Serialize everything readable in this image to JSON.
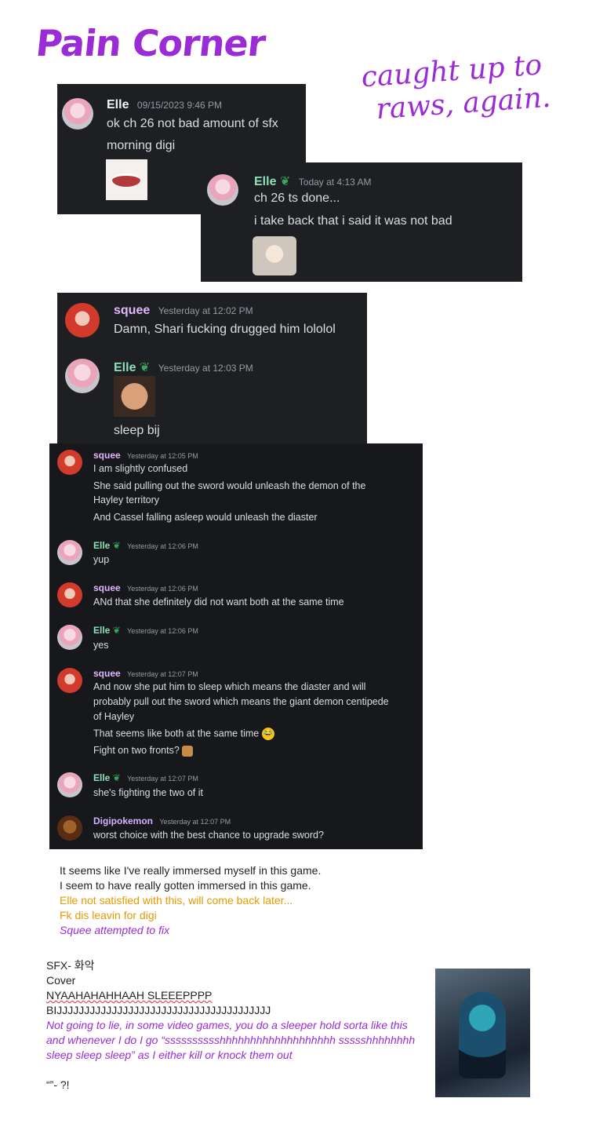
{
  "title": "Pain Corner",
  "note": [
    "caught up to",
    "raws, again."
  ],
  "panel1": {
    "name": "Elle",
    "time": "09/15/2023 9:46 PM",
    "lines": [
      "ok ch 26 not bad amount of sfx",
      "morning digi"
    ]
  },
  "panel2": {
    "name": "Elle",
    "time": "Today at 4:13 AM",
    "lines": [
      "ch 26 ts done...",
      "i take back that i said it was not bad"
    ]
  },
  "panel3": {
    "m1": {
      "name": "squee",
      "time": "Yesterday at 12:02 PM",
      "text": "Damn, Shari fucking drugged him lololol"
    },
    "m2": {
      "name": "Elle",
      "time": "Yesterday at 12:03 PM",
      "text": "sleep bij"
    }
  },
  "panel4": {
    "g1": {
      "name": "squee",
      "time": "Yesterday at 12:05 PM",
      "lines": [
        "I am slightly confused",
        "She said pulling out the sword would unleash the demon of the",
        "Hayley territory",
        "And Cassel falling asleep would unleash the diaster"
      ]
    },
    "g2": {
      "name": "Elle",
      "time": "Yesterday at 12:06 PM",
      "lines": [
        "yup"
      ]
    },
    "g3": {
      "name": "squee",
      "time": "Yesterday at 12:06 PM",
      "lines": [
        "ANd that she definitely did not want both at the same time"
      ]
    },
    "g4": {
      "name": "Elle",
      "time": "Yesterday at 12:06 PM",
      "lines": [
        "yes"
      ]
    },
    "g5": {
      "name": "squee",
      "time": "Yesterday at 12:07 PM",
      "lines": [
        "And now she put him to sleep which means the diaster and will",
        "probably pull out the sword which means the giant demon centipede",
        "of Hayley",
        "That seems like both at the same time",
        "Fight on two fronts?"
      ]
    },
    "g6": {
      "name": "Elle",
      "time": "Yesterday at 12:07 PM",
      "lines": [
        "she's fighting the two of it"
      ]
    },
    "g7": {
      "name": "Digipokemon",
      "time": "Yesterday at 12:07 PM",
      "lines": [
        "worst choice with the best chance to upgrade sword?"
      ]
    }
  },
  "doc1": {
    "l1": "It seems like I've really immersed myself in this game.",
    "l2": "I seem to have really gotten immersed in this game.",
    "l3": "Elle not satisfied with this, will come back later...",
    "l4": "Fk dis leavin for digi",
    "l5": "Squee attempted to fix"
  },
  "doc2": {
    "l1": "SFX- 화악",
    "l2": "Cover",
    "l3": "NYAAHAHAHHAAH SLEEEPPPP",
    "l4": "BIJJJJJJJJJJJJJJJJJJJJJJJJJJJJJJJJJJJJJJJ",
    "l5": "Not going to lie, in some video games, you do a sleeper hold sorta like this",
    "l6": "and whenever I do I go “sssssssssshhhhhhhhhhhhhhhhhhh ssssshhhhhhhh",
    "l7": "sleep sleep sleep” as I either kill or knock them out",
    "l8": "“”- ?!"
  },
  "colors": {
    "accent": "#9b2bd6",
    "orange": "#e69a00",
    "panel": "#1e1f22",
    "elle": "#8be0b5",
    "squee": "#e1b8ff"
  }
}
